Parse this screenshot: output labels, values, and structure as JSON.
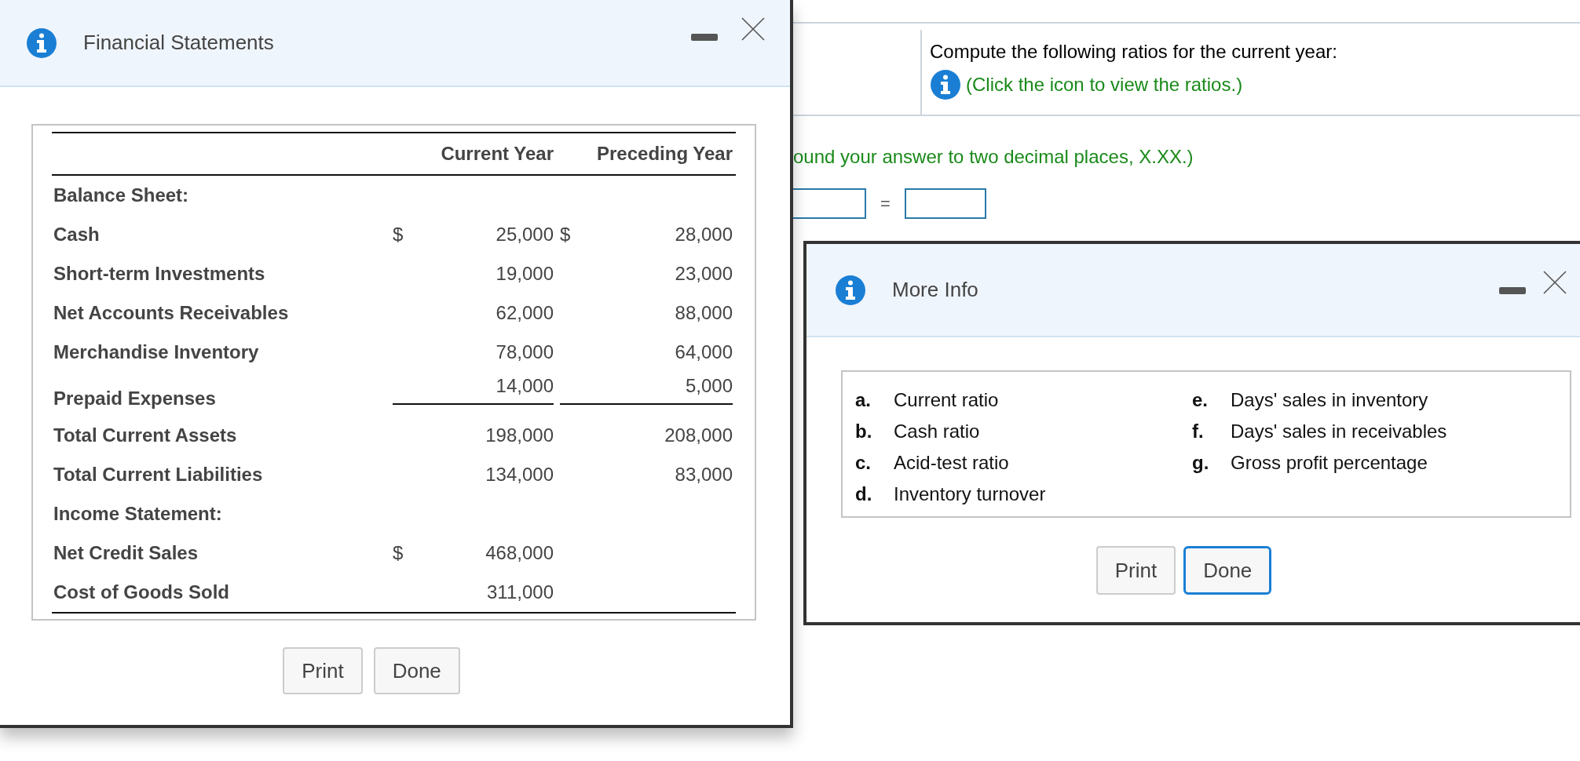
{
  "background_page": {
    "prompt": "Compute the following ratios for the current year:",
    "hint": "(Click the icon to view the ratios.)",
    "rounding_note": "ound your answer to two decimal places, X.XX.)",
    "equation_operator": "="
  },
  "financial_statements_dialog": {
    "title": "Financial Statements",
    "columns": [
      "Current Year",
      "Preceding Year"
    ],
    "rows": [
      {
        "kind": "heading",
        "label": "Balance Sheet:"
      },
      {
        "kind": "line",
        "label": "Cash",
        "current_symbol": "$",
        "current": "25,000",
        "preceding_symbol": "$",
        "preceding": "28,000",
        "underlined": false
      },
      {
        "kind": "line",
        "label": "Short-term Investments",
        "current": "19,000",
        "preceding": "23,000",
        "underlined": false
      },
      {
        "kind": "line",
        "label": "Net Accounts Receivables",
        "current": "62,000",
        "preceding": "88,000",
        "underlined": false
      },
      {
        "kind": "line",
        "label": "Merchandise Inventory",
        "current": "78,000",
        "preceding": "64,000",
        "underlined": false
      },
      {
        "kind": "line",
        "label": "Prepaid Expenses",
        "current": "14,000",
        "preceding": "5,000",
        "underlined": true
      },
      {
        "kind": "line",
        "label": "Total Current Assets",
        "current": "198,000",
        "preceding": "208,000",
        "underlined": false
      },
      {
        "kind": "line",
        "label": "Total Current Liabilities",
        "current": "134,000",
        "preceding": "83,000",
        "underlined": false
      },
      {
        "kind": "heading",
        "label": "Income Statement:"
      },
      {
        "kind": "line",
        "label": "Net Credit Sales",
        "current_symbol": "$",
        "current": "468,000",
        "underlined": false
      },
      {
        "kind": "line",
        "label": "Cost of Goods Sold",
        "current": "311,000",
        "underlined": false
      }
    ],
    "buttons": [
      {
        "label": "Print",
        "focused": false
      },
      {
        "label": "Done",
        "focused": false
      }
    ]
  },
  "more_info_dialog": {
    "title": "More Info",
    "items": [
      {
        "letter": "a.",
        "text": "Current ratio"
      },
      {
        "letter": "b.",
        "text": "Cash ratio"
      },
      {
        "letter": "c.",
        "text": "Acid-test ratio"
      },
      {
        "letter": "d.",
        "text": "Inventory turnover"
      },
      {
        "letter": "e.",
        "text": "Days' sales in inventory"
      },
      {
        "letter": "f.",
        "text": "Days' sales in receivables"
      },
      {
        "letter": "g.",
        "text": "Gross profit percentage"
      }
    ],
    "buttons": [
      {
        "label": "Print",
        "focused": false
      },
      {
        "label": "Done",
        "focused": true
      }
    ]
  }
}
